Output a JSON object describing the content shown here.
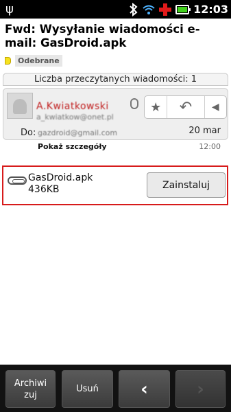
{
  "status": {
    "time": "12:03",
    "icons": [
      "usb-icon",
      "bluetooth-icon",
      "wifi-icon",
      "red-cross-icon",
      "battery-icon"
    ],
    "battery_color": "#42d21d"
  },
  "email": {
    "subject": "Fwd: Wysyłanie wiadomości e-mail: GasDroid.apk",
    "label": "Odebrane",
    "read_count": "Liczba przeczytanych wiadomości: 1",
    "sender_name": "A.Kwiatkowski",
    "sender_email": "a_kwiatkow@onet.pl",
    "to_label": "Do:",
    "to_value": "gazdroid@gmail.com",
    "date": "20 mar",
    "time": "12:00",
    "details_label": "Pokaż szczegóły"
  },
  "attachment": {
    "name": "GasDroid.apk",
    "size": "436KB",
    "install_label": "Zainstaluj",
    "highlight_color": "#d71b1b"
  },
  "bottom": {
    "archive_label": "Archiwizuj",
    "delete_label": "Usuń",
    "prev": "‹",
    "next": "›"
  }
}
